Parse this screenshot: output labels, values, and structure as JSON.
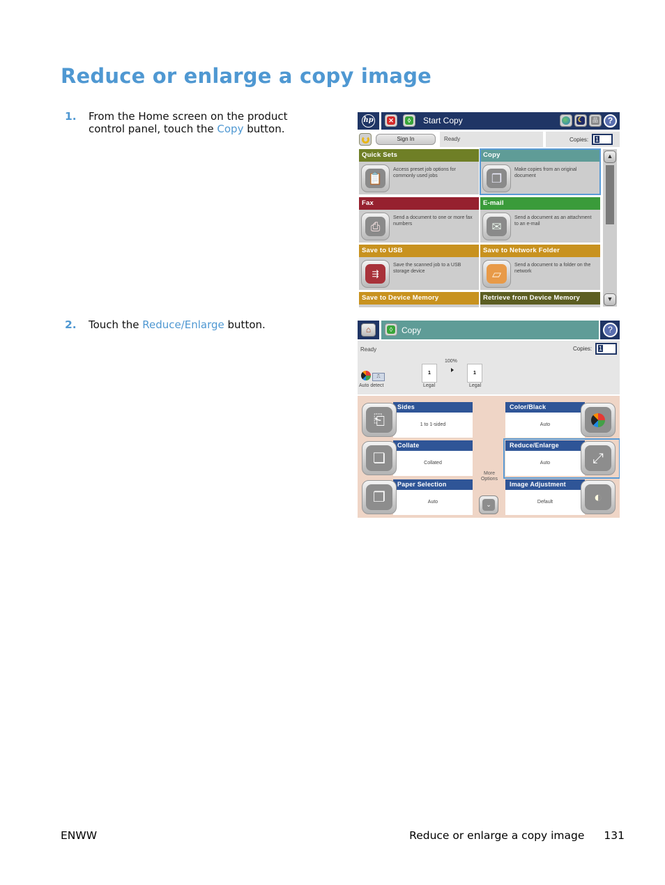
{
  "page": {
    "title": "Reduce or enlarge a copy image",
    "accent_color": "#4f98d2"
  },
  "steps": [
    {
      "number": "1.",
      "text_before": "From the Home screen on the product control panel, touch the ",
      "link": "Copy",
      "text_after": " button."
    },
    {
      "number": "2.",
      "text_before": "Touch the ",
      "link": "Reduce/Enlarge",
      "text_after": " button."
    }
  ],
  "home_screen": {
    "logo": "hp",
    "title": "Start Copy",
    "icons": {
      "stop": "stop-icon",
      "start": "start-icon",
      "language": "globe-icon",
      "sleep": "moon-icon",
      "network": "network-icon",
      "help": "help-icon"
    },
    "sign_in_label": "Sign In",
    "status": "Ready",
    "copies_label": "Copies:",
    "copies_value": "1",
    "tiles": [
      {
        "title": "Quick Sets",
        "description": "Access preset job options for commonly used jobs",
        "color": "#6f7f26",
        "icon": "clipboard-icon"
      },
      {
        "title": "Copy",
        "description": "Make copies from an original document",
        "color": "#5f9c97",
        "icon": "copy-icon",
        "selected": true
      },
      {
        "title": "Fax",
        "description": "Send a document to one or more fax numbers",
        "color": "#96212f",
        "icon": "fax-icon"
      },
      {
        "title": "E-mail",
        "description": "Send a document as an attachment to an e-mail",
        "color": "#3a9b3a",
        "icon": "envelope-icon"
      },
      {
        "title": "Save to USB",
        "description": "Save the scanned job to a USB storage device",
        "color": "#c8921f",
        "icon": "usb-icon"
      },
      {
        "title": "Save to Network Folder",
        "description": "Send a document to a folder on the network",
        "color": "#c8921f",
        "icon": "folder-icon"
      },
      {
        "title": "Save to Device Memory",
        "description": "",
        "color": "#c8921f",
        "icon": ""
      },
      {
        "title": "Retrieve from Device Memory",
        "description": "",
        "color": "#5c5e22",
        "icon": ""
      }
    ],
    "scroll_up": "▲",
    "scroll_down": "▼"
  },
  "copy_screen": {
    "title": "Copy",
    "status": "Ready",
    "copies_label": "Copies:",
    "copies_value": "1",
    "auto_detect_label": "Auto detect",
    "zoom_percent": "100%",
    "original_page": "1",
    "output_page": "1",
    "original_size": "Legal",
    "output_size": "Legal",
    "more_options_label": "More Options",
    "options": [
      {
        "title": "Sides",
        "value": "1 to 1-sided",
        "icon": "sides-icon"
      },
      {
        "title": "Color/Black",
        "value": "Auto",
        "icon": "color-icon"
      },
      {
        "title": "Collate",
        "value": "Collated",
        "icon": "collate-icon"
      },
      {
        "title": "Reduce/Enlarge",
        "value": "Auto",
        "icon": "reduce-enlarge-icon",
        "selected": true
      },
      {
        "title": "Paper Selection",
        "value": "Auto",
        "icon": "paper-icon"
      },
      {
        "title": "Image Adjustment",
        "value": "Default",
        "icon": "image-adjust-icon"
      }
    ]
  },
  "footer": {
    "left": "ENWW",
    "section": "Reduce or enlarge a copy image",
    "page_number": "131"
  }
}
